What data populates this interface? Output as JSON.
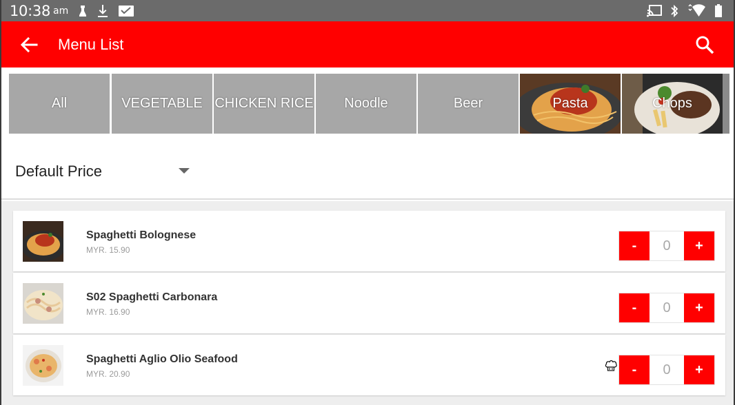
{
  "status_bar": {
    "time": "10:38",
    "ampm": "am",
    "left_icons": [
      "notification-icon",
      "download-icon",
      "mail-icon"
    ],
    "right_icons": [
      "cast-icon",
      "bluetooth-icon",
      "wifi-icon",
      "battery-icon"
    ]
  },
  "app_bar": {
    "title": "Menu List",
    "back_icon": "back-arrow-icon",
    "search_icon": "search-icon",
    "color": "#ff0000"
  },
  "categories": [
    {
      "label": "All"
    },
    {
      "label": "VEGETABLE"
    },
    {
      "label": "CHICKEN RICE"
    },
    {
      "label": "Noodle"
    },
    {
      "label": "Beer"
    },
    {
      "label": "Pasta"
    },
    {
      "label": "Chops"
    }
  ],
  "price_selector": {
    "selected": "Default Price"
  },
  "items": [
    {
      "name": "Spaghetti Bolognese",
      "price": "MYR. 15.90",
      "qty": "0",
      "minus": "-",
      "plus": "+"
    },
    {
      "name": "S02 Spaghetti Carbonara",
      "price": "MYR. 16.90",
      "qty": "0",
      "minus": "-",
      "plus": "+"
    },
    {
      "name": "Spaghetti Aglio Olio Seafood",
      "price": "MYR. 20.90",
      "qty": "0",
      "minus": "-",
      "plus": "+"
    }
  ],
  "colors": {
    "accent": "#ff0000",
    "tile": "#a7a7a7",
    "status_bar": "#6b6b6b"
  }
}
